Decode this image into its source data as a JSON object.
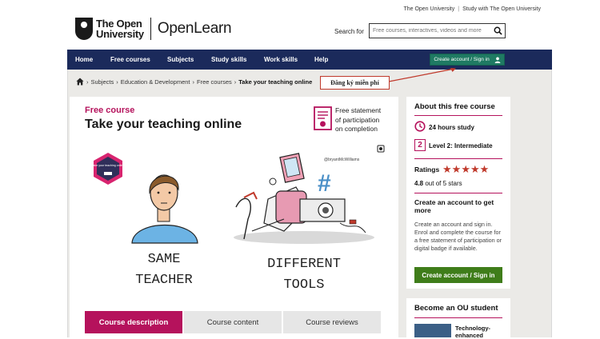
{
  "header": {
    "top_links": [
      "The Open University",
      "Study with The Open University"
    ],
    "logo_line1": "The Open",
    "logo_line2": "University",
    "brand": "OpenLearn",
    "search_label": "Search for",
    "search_placeholder": "Free courses, interactives, videos and more",
    "icons": [
      "ou-shield-logo",
      "search-icon"
    ]
  },
  "nav": {
    "items": [
      "Home",
      "Free courses",
      "Subjects",
      "Study skills",
      "Work skills",
      "Help"
    ],
    "account_button": "Create account / Sign in",
    "colors": {
      "bar": "#1b2a5b",
      "button": "#1f7a63"
    }
  },
  "breadcrumb": {
    "items": [
      "Subjects",
      "Education & Development",
      "Free courses"
    ],
    "current": "Take your teaching online"
  },
  "annotation": {
    "text": "Đăng ký miễn phí",
    "color": "#c0392b"
  },
  "course": {
    "label": "Free course",
    "title": "Take your teaching online",
    "cert_line1": "Free statement",
    "cert_line2": "of participation",
    "cert_line3": "on completion",
    "hero": {
      "badge_text": "Take your teaching online",
      "credit": "@bryantMcWilliams",
      "left_caption_1": "SAME",
      "left_caption_2": "TEACHER",
      "right_caption_1": "DIFFERENT",
      "right_caption_2": "TOOLS"
    },
    "tabs": [
      "Course description",
      "Course content",
      "Course reviews"
    ],
    "accent": "#b5125c"
  },
  "sidebar": {
    "heading": "About this free course",
    "hours": "24 hours study",
    "level_num": "2",
    "level": "Level 2: Intermediate",
    "ratings_label": "Ratings",
    "stars": 5,
    "rating_value": "4.8",
    "rating_suffix": "out of 5 stars",
    "create_heading": "Create an account to get more",
    "create_text": "Create an account and sign in. Enrol and complete the course for a free statement of participation or digital badge if available.",
    "create_button": "Create account / Sign in",
    "button_color": "#3f7d1a"
  },
  "sidebar2": {
    "heading": "Become an OU student",
    "item": "Technology-enhanced"
  }
}
